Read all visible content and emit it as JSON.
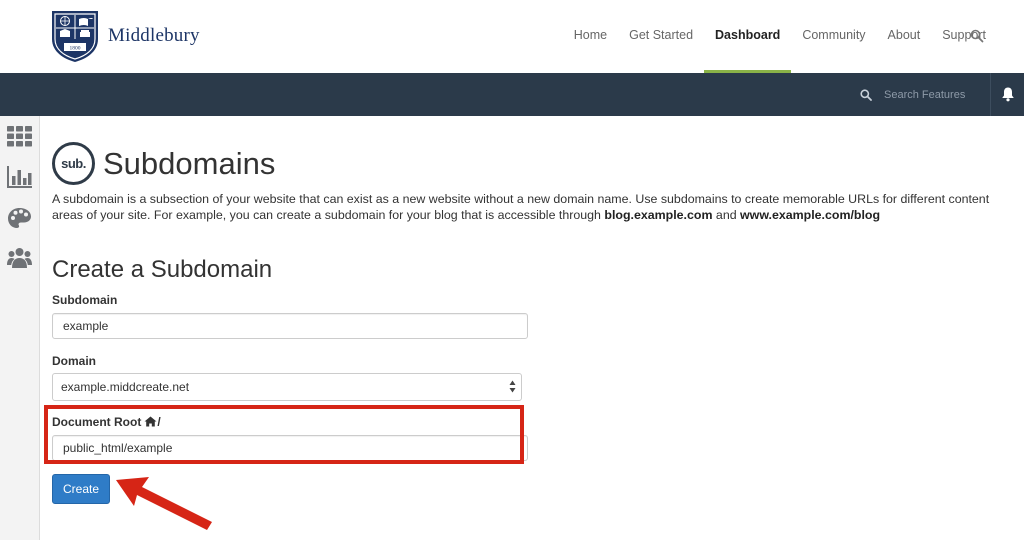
{
  "brand": {
    "name": "Middlebury",
    "crest_year": "1800"
  },
  "nav": {
    "items": [
      {
        "label": "Home"
      },
      {
        "label": "Get Started"
      },
      {
        "label": "Dashboard",
        "active": true
      },
      {
        "label": "Community"
      },
      {
        "label": "About"
      },
      {
        "label": "Support"
      }
    ],
    "search_icon": "search-icon"
  },
  "toolbar": {
    "search_placeholder": "Search Features",
    "bell_icon": "bell-icon"
  },
  "sidebar": {
    "icons": [
      "grid-icon",
      "bar-chart-icon",
      "palette-icon",
      "users-icon"
    ]
  },
  "page": {
    "badge": "sub.",
    "title": "Subdomains",
    "description_text": "A subdomain is a subsection of your website that can exist as a new website without a new domain name. Use subdomains to create memorable URLs for different content areas of your site. For example, you can create a subdomain for your blog that is accessible through ",
    "description_example1": "blog.example.com",
    "description_and": " and ",
    "description_example2": "www.example.com/blog"
  },
  "form": {
    "section_title": "Create a Subdomain",
    "subdomain_label": "Subdomain",
    "subdomain_value": "example",
    "domain_label": "Domain",
    "domain_value": "example.middcreate.net",
    "docroot_label": "Document Root",
    "docroot_suffix": "/",
    "docroot_value": "public_html/example",
    "create_label": "Create"
  },
  "colors": {
    "nav_active_underline": "#8ab348",
    "cpanel_bar": "#2b3a4a",
    "primary_button": "#2f7cc7",
    "annotation_red": "#d62516",
    "brand_navy": "#1d3566"
  }
}
